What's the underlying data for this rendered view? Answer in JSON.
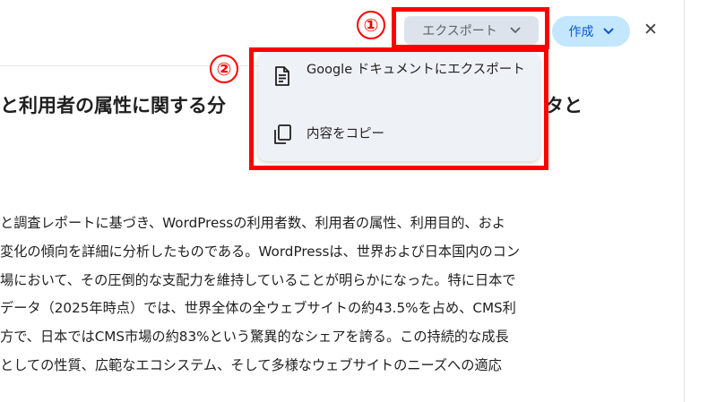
{
  "toolbar": {
    "export_label": "エクスポート",
    "create_label": "作成",
    "close_glyph": "✕",
    "chevron_glyph": "⌄"
  },
  "annotations": {
    "marker_1": "①",
    "marker_2": "②",
    "highlight_color": "#ff0000"
  },
  "export_menu": {
    "items": [
      {
        "label": "Google ドキュメントにエクスポート",
        "icon": "google-docs-icon"
      },
      {
        "label": "内容をコピー",
        "icon": "copy-icon"
      }
    ]
  },
  "document": {
    "title_left": "と利用者の属性に関する分",
    "title_right": "タと",
    "lines": [
      "と調査レポートに基づき、WordPressの利用者数、利用者の属性、利用目的、およ",
      "変化の傾向を詳細に分析したものである。WordPressは、世界および日本国内のコン",
      "場において、その圧倒的な支配力を維持していることが明らかになった。特に日本で",
      "データ（2025年時点）では、世界全体の全ウェブサイトの約43.5%を占め、CMS利",
      "方で、日本ではCMS市場の約83%という驚異的なシェアを誇る。この持続的な成長",
      "としての性質、広範なエコシステム、そして多様なウェブサイトのニーズへの適応"
    ]
  },
  "colors": {
    "export_button_bg": "#dde3ec",
    "create_button_bg": "#c2e7ff",
    "create_button_text": "#0b57d0",
    "menu_bg": "#eef2f7"
  }
}
